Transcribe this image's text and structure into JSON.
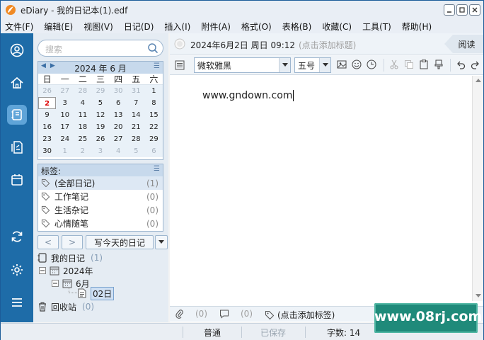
{
  "window": {
    "title": "eDiary - 我的日记本(1).edf"
  },
  "menu": [
    "文件(F)",
    "编辑(E)",
    "视图(V)",
    "日记(D)",
    "插入(I)",
    "附件(A)",
    "格式(O)",
    "表格(B)",
    "收藏(C)",
    "工具(T)",
    "帮助(H)"
  ],
  "sidebar_icons": [
    "user-icon",
    "home-icon",
    "diary-icon",
    "notes-icon",
    "calendar-icon",
    "sync-icon",
    "settings-icon",
    "menu-icon"
  ],
  "search": {
    "placeholder": "搜索"
  },
  "calendar": {
    "title": "2024 年 6 月",
    "weekdays": [
      "日",
      "一",
      "二",
      "三",
      "四",
      "五",
      "六"
    ],
    "days": [
      [
        "26",
        "27",
        "28",
        "29",
        "30",
        "31",
        "1"
      ],
      [
        "2",
        "3",
        "4",
        "5",
        "6",
        "7",
        "8"
      ],
      [
        "9",
        "10",
        "11",
        "12",
        "13",
        "14",
        "15"
      ],
      [
        "16",
        "17",
        "18",
        "19",
        "20",
        "21",
        "22"
      ],
      [
        "23",
        "24",
        "25",
        "26",
        "27",
        "28",
        "29"
      ],
      [
        "30",
        "1",
        "2",
        "3",
        "4",
        "5",
        "6"
      ]
    ],
    "selected_day": "2"
  },
  "tags": {
    "header": "标签:",
    "items": [
      {
        "label": "(全部日记)",
        "count": "(1)"
      },
      {
        "label": "工作笔记",
        "count": "(0)"
      },
      {
        "label": "生活杂记",
        "count": "(0)"
      },
      {
        "label": "心情随笔",
        "count": "(0)"
      }
    ]
  },
  "buttons": {
    "prev": "<",
    "next": ">",
    "write_today": "写今天的日记"
  },
  "tree": {
    "root": "我的日记",
    "root_count": "(1)",
    "year": "2024年",
    "month": "6月",
    "day": "02日",
    "trash": "回收站",
    "trash_count": "(0)"
  },
  "entry": {
    "date": "2024年6月2日 周日 09:12",
    "title_placeholder": "(点击添加标题)",
    "read_button": "阅读",
    "font": "微软雅黑",
    "size": "五号",
    "content": "www.gndown.com"
  },
  "footer": {
    "attachments": "(0)",
    "comments": "(0)",
    "tag_placeholder": "(点击添加标签)"
  },
  "status": {
    "mode": "普通",
    "saved": "已保存",
    "chars": "字数: 14"
  },
  "watermark": "www.08rj.com"
}
